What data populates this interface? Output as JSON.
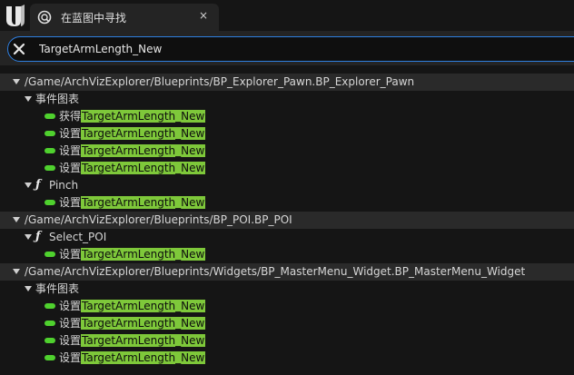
{
  "tab": {
    "title": "在蓝图中寻找",
    "close_glyph": "×"
  },
  "search": {
    "value": "TargetArmLength_New",
    "placeholder": ""
  },
  "results": {
    "groups": [
      {
        "path": "/Game/ArchVizExplorer/Blueprints/BP_Explorer_Pawn.BP_Explorer_Pawn",
        "sections": [
          {
            "label": "事件图表",
            "icon": "none",
            "items": [
              {
                "prefix": "获得",
                "match": "TargetArmLength_New"
              },
              {
                "prefix": "设置",
                "match": "TargetArmLength_New"
              },
              {
                "prefix": "设置",
                "match": "TargetArmLength_New"
              },
              {
                "prefix": "设置",
                "match": "TargetArmLength_New"
              }
            ]
          },
          {
            "label": "Pinch",
            "icon": "function-icon",
            "items": [
              {
                "prefix": "设置",
                "match": "TargetArmLength_New"
              }
            ]
          }
        ]
      },
      {
        "path": "/Game/ArchVizExplorer/Blueprints/BP_POI.BP_POI",
        "sections": [
          {
            "label": "Select_POI",
            "icon": "function-icon",
            "items": [
              {
                "prefix": "设置",
                "match": "TargetArmLength_New"
              }
            ]
          }
        ]
      },
      {
        "path": "/Game/ArchVizExplorer/Blueprints/Widgets/BP_MasterMenu_Widget.BP_MasterMenu_Widget",
        "sections": [
          {
            "label": "事件图表",
            "icon": "none",
            "items": [
              {
                "prefix": "设置",
                "match": "TargetArmLength_New"
              },
              {
                "prefix": "设置",
                "match": "TargetArmLength_New"
              },
              {
                "prefix": "设置",
                "match": "TargetArmLength_New"
              },
              {
                "prefix": "设置",
                "match": "TargetArmLength_New"
              }
            ]
          }
        ]
      }
    ]
  },
  "colors": {
    "highlight": "#7ec83a",
    "pin": "#4fd12e",
    "search_border": "#2f7fe0",
    "header_row": "#2a2a2a"
  }
}
